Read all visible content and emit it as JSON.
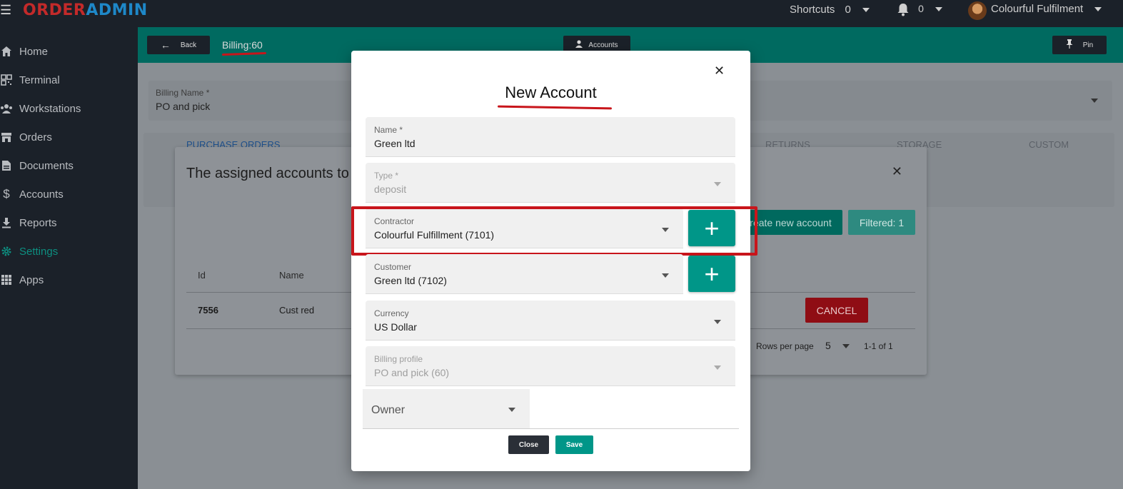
{
  "topbar": {
    "logo_part1": "ORDER",
    "logo_part2": "ADMIN",
    "shortcuts_label": "Shortcuts",
    "shortcuts_count": "0",
    "notifications_count": "0",
    "user_name": "Colourful Fulfilment"
  },
  "sidebar": {
    "items": [
      {
        "label": "Home",
        "icon": "home-icon"
      },
      {
        "label": "Terminal",
        "icon": "qr-icon"
      },
      {
        "label": "Workstations",
        "icon": "people-icon"
      },
      {
        "label": "Orders",
        "icon": "store-icon"
      },
      {
        "label": "Documents",
        "icon": "document-icon"
      },
      {
        "label": "Accounts",
        "icon": "dollar-icon"
      },
      {
        "label": "Reports",
        "icon": "download-icon"
      },
      {
        "label": "Settings",
        "icon": "gear-icon"
      },
      {
        "label": "Apps",
        "icon": "grid-icon"
      }
    ],
    "active": "Settings",
    "active_color": "#0d8f80"
  },
  "header": {
    "back_label": "Back",
    "billing_id": "Billing:60",
    "accounts_label": "Accounts",
    "pin_label": "Pin"
  },
  "billing_field": {
    "label": "Billing Name *",
    "value": "PO and pick"
  },
  "tabs": [
    "PURCHASE ORDERS",
    "RETURNS",
    "STORAGE",
    "CUSTOM"
  ],
  "assigned_dialog": {
    "title": "The assigned accounts to",
    "create_label": "reate new account",
    "filtered_label": "Filtered: 1",
    "columns": [
      "Id",
      "Name"
    ],
    "row": {
      "id": "7556",
      "name": "Cust red",
      "cancel_label": "CANCEL"
    },
    "rows_per_page_label": "Rows per page",
    "rows_per_page_value": "5",
    "range_label": "1-1 of 1"
  },
  "modal": {
    "title": "New Account",
    "fields": {
      "name": {
        "label": "Name *",
        "value": "Green ltd"
      },
      "type": {
        "label": "Type *",
        "value": "deposit"
      },
      "contractor": {
        "label": "Contractor",
        "value": "Colourful Fulfillment (7101)"
      },
      "customer": {
        "label": "Customer",
        "value": "Green ltd (7102)"
      },
      "currency": {
        "label": "Currency",
        "value": "US Dollar"
      },
      "billing_profile": {
        "label": "Billing profile",
        "value": "PO and pick  (60)"
      },
      "owner": {
        "placeholder": "Owner"
      }
    },
    "plus_label": "+",
    "close_label": "Close",
    "save_label": "Save"
  },
  "colors": {
    "accent": "#009688",
    "header": "#006a60",
    "highlight": "#c8151b",
    "cancel": "#8f0d14"
  }
}
